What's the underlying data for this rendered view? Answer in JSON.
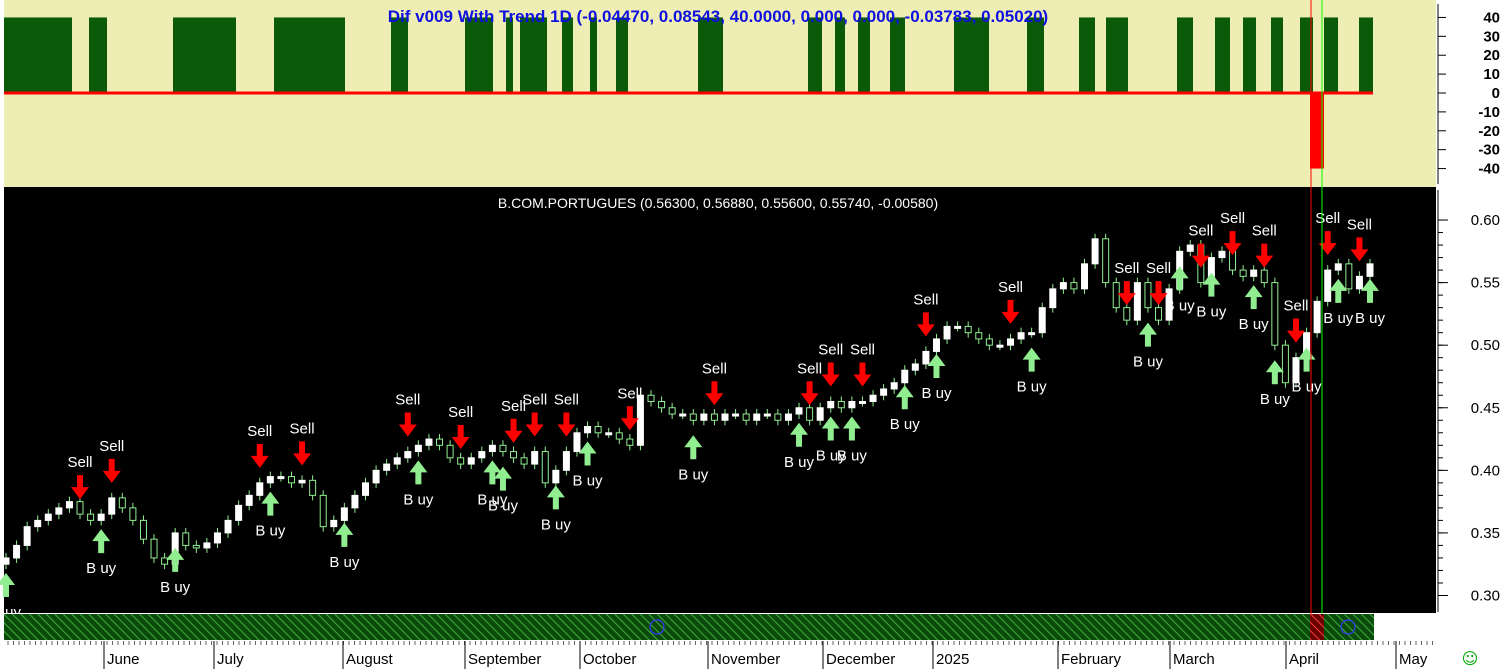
{
  "indicator": {
    "title": "Dif v009 With Trend 1D (-0.04470, 0.08543, 40.0000, 0.000, 0.000, -0.03783, 0.05020)",
    "y_ticks": [
      "40",
      "30",
      "20",
      "10",
      "0",
      "-10",
      "-20",
      "-30",
      "-40"
    ]
  },
  "price": {
    "title": "B.COM.PORTUGUES (0.56300, 0.56880, 0.55600, 0.55740, -0.00580)",
    "y_ticks": [
      "0.60",
      "0.55",
      "0.50",
      "0.45",
      "0.40",
      "0.35",
      "0.30"
    ]
  },
  "months": [
    "June",
    "July",
    "August",
    "September",
    "October",
    "November",
    "December",
    "2025",
    "February",
    "March",
    "April",
    "May"
  ],
  "colors": {
    "indicator_bg": "#eeeeb4",
    "indicator_bar": "#0a5a0a",
    "indicator_neg": "#ff0000",
    "price_bg": "#000000",
    "up_candle": "#ffffff",
    "wick": "#90ee90",
    "sell": "#ff0000",
    "buy": "#90ee90",
    "smiley": "#00aa00"
  },
  "signal_labels": {
    "sell": "Sell",
    "buy": "B uy"
  },
  "smiley": "☺",
  "chart_data": [
    {
      "type": "bar",
      "title": "Dif v009 With Trend 1D (-0.04470, 0.08543, 40.0000, 0.000, 0.000, -0.03783, 0.05020)",
      "ylim": [
        -45,
        45
      ],
      "ticks": [
        40,
        30,
        20,
        10,
        0,
        -10,
        -20,
        -30,
        -40
      ],
      "positive_blocks_level": 40,
      "negative_spike": {
        "month": "April",
        "value": -40
      }
    },
    {
      "type": "candlestick",
      "title": "B.COM.PORTUGUES (0.56300, 0.56880, 0.55600, 0.55740, -0.00580)",
      "last": {
        "open": 0.563,
        "high": 0.5688,
        "low": 0.556,
        "close": 0.5574,
        "change": -0.0058
      },
      "ylim": [
        0.29,
        0.62
      ],
      "ticks": [
        0.6,
        0.55,
        0.5,
        0.45,
        0.4,
        0.35,
        0.3
      ],
      "months": [
        "June",
        "July",
        "August",
        "September",
        "October",
        "November",
        "December",
        "2025",
        "February",
        "March",
        "April",
        "May"
      ],
      "close_path": [
        [
          0,
          0.33
        ],
        [
          1,
          0.34
        ],
        [
          2,
          0.355
        ],
        [
          3,
          0.36
        ],
        [
          4,
          0.365
        ],
        [
          5,
          0.37
        ],
        [
          6,
          0.375
        ],
        [
          7,
          0.365
        ],
        [
          8,
          0.36
        ],
        [
          9,
          0.365
        ],
        [
          10,
          0.378
        ],
        [
          11,
          0.37
        ],
        [
          12,
          0.36
        ],
        [
          13,
          0.345
        ],
        [
          14,
          0.33
        ],
        [
          15,
          0.325
        ],
        [
          16,
          0.35
        ],
        [
          17,
          0.34
        ],
        [
          18,
          0.338
        ],
        [
          19,
          0.342
        ],
        [
          20,
          0.35
        ],
        [
          21,
          0.36
        ],
        [
          22,
          0.372
        ],
        [
          23,
          0.38
        ],
        [
          24,
          0.39
        ],
        [
          25,
          0.395
        ],
        [
          26,
          0.395
        ],
        [
          27,
          0.39
        ],
        [
          28,
          0.392
        ],
        [
          29,
          0.38
        ],
        [
          30,
          0.355
        ],
        [
          31,
          0.36
        ],
        [
          32,
          0.37
        ],
        [
          33,
          0.38
        ],
        [
          34,
          0.39
        ],
        [
          35,
          0.4
        ],
        [
          36,
          0.405
        ],
        [
          37,
          0.41
        ],
        [
          38,
          0.415
        ],
        [
          39,
          0.42
        ],
        [
          40,
          0.425
        ],
        [
          41,
          0.42
        ],
        [
          42,
          0.41
        ],
        [
          43,
          0.405
        ],
        [
          44,
          0.41
        ],
        [
          45,
          0.415
        ],
        [
          46,
          0.42
        ],
        [
          47,
          0.415
        ],
        [
          48,
          0.41
        ],
        [
          49,
          0.405
        ],
        [
          50,
          0.415
        ],
        [
          51,
          0.39
        ],
        [
          52,
          0.4
        ],
        [
          53,
          0.415
        ],
        [
          54,
          0.43
        ],
        [
          55,
          0.435
        ],
        [
          56,
          0.43
        ],
        [
          57,
          0.43
        ],
        [
          58,
          0.425
        ],
        [
          59,
          0.42
        ],
        [
          60,
          0.46
        ],
        [
          61,
          0.455
        ],
        [
          62,
          0.45
        ],
        [
          63,
          0.445
        ],
        [
          64,
          0.445
        ],
        [
          65,
          0.44
        ],
        [
          66,
          0.445
        ],
        [
          67,
          0.44
        ],
        [
          68,
          0.445
        ],
        [
          69,
          0.445
        ],
        [
          70,
          0.44
        ],
        [
          71,
          0.445
        ],
        [
          72,
          0.445
        ],
        [
          73,
          0.44
        ],
        [
          74,
          0.445
        ],
        [
          75,
          0.45
        ],
        [
          76,
          0.44
        ],
        [
          77,
          0.45
        ],
        [
          78,
          0.455
        ],
        [
          79,
          0.45
        ],
        [
          80,
          0.455
        ],
        [
          81,
          0.455
        ],
        [
          82,
          0.46
        ],
        [
          83,
          0.465
        ],
        [
          84,
          0.47
        ],
        [
          85,
          0.48
        ],
        [
          86,
          0.485
        ],
        [
          87,
          0.495
        ],
        [
          88,
          0.505
        ],
        [
          89,
          0.515
        ],
        [
          90,
          0.515
        ],
        [
          91,
          0.51
        ],
        [
          92,
          0.505
        ],
        [
          93,
          0.5
        ],
        [
          94,
          0.5
        ],
        [
          95,
          0.505
        ],
        [
          96,
          0.51
        ],
        [
          97,
          0.51
        ],
        [
          98,
          0.53
        ],
        [
          99,
          0.545
        ],
        [
          100,
          0.55
        ],
        [
          101,
          0.545
        ],
        [
          102,
          0.565
        ],
        [
          103,
          0.585
        ],
        [
          104,
          0.55
        ],
        [
          105,
          0.53
        ],
        [
          106,
          0.52
        ],
        [
          107,
          0.55
        ],
        [
          108,
          0.53
        ],
        [
          109,
          0.52
        ],
        [
          110,
          0.545
        ],
        [
          111,
          0.575
        ],
        [
          112,
          0.58
        ],
        [
          113,
          0.55
        ],
        [
          114,
          0.57
        ],
        [
          115,
          0.575
        ],
        [
          116,
          0.56
        ],
        [
          117,
          0.555
        ],
        [
          118,
          0.56
        ],
        [
          119,
          0.55
        ],
        [
          120,
          0.5
        ],
        [
          121,
          0.47
        ],
        [
          122,
          0.49
        ],
        [
          123,
          0.51
        ],
        [
          124,
          0.535
        ],
        [
          125,
          0.56
        ],
        [
          126,
          0.565
        ],
        [
          127,
          0.545
        ],
        [
          128,
          0.555
        ],
        [
          129,
          0.565
        ]
      ],
      "signals": [
        {
          "type": "buy",
          "x": 0
        },
        {
          "type": "sell",
          "x": 7
        },
        {
          "type": "buy",
          "x": 9
        },
        {
          "type": "sell",
          "x": 10
        },
        {
          "type": "buy",
          "x": 16
        },
        {
          "type": "sell",
          "x": 24
        },
        {
          "type": "buy",
          "x": 25
        },
        {
          "type": "sell",
          "x": 28
        },
        {
          "type": "buy",
          "x": 32
        },
        {
          "type": "sell",
          "x": 38
        },
        {
          "type": "buy",
          "x": 39
        },
        {
          "type": "sell",
          "x": 43
        },
        {
          "type": "buy",
          "x": 46
        },
        {
          "type": "sell",
          "x": 48
        },
        {
          "type": "buy",
          "x": 47
        },
        {
          "type": "sell",
          "x": 50
        },
        {
          "type": "buy",
          "x": 52
        },
        {
          "type": "sell",
          "x": 53
        },
        {
          "type": "buy",
          "x": 55
        },
        {
          "type": "sell",
          "x": 59
        },
        {
          "type": "buy",
          "x": 65
        },
        {
          "type": "sell",
          "x": 67
        },
        {
          "type": "sell",
          "x": 76
        },
        {
          "type": "buy",
          "x": 75
        },
        {
          "type": "sell",
          "x": 78
        },
        {
          "type": "buy",
          "x": 78
        },
        {
          "type": "sell",
          "x": 81
        },
        {
          "type": "buy",
          "x": 80
        },
        {
          "type": "buy",
          "x": 85
        },
        {
          "type": "sell",
          "x": 87
        },
        {
          "type": "buy",
          "x": 88
        },
        {
          "type": "sell",
          "x": 95
        },
        {
          "type": "buy",
          "x": 97
        },
        {
          "type": "sell",
          "x": 106
        },
        {
          "type": "buy",
          "x": 108
        },
        {
          "type": "sell",
          "x": 109
        },
        {
          "type": "buy",
          "x": 111
        },
        {
          "type": "sell",
          "x": 113
        },
        {
          "type": "buy",
          "x": 114
        },
        {
          "type": "sell",
          "x": 116
        },
        {
          "type": "buy",
          "x": 118
        },
        {
          "type": "sell",
          "x": 119
        },
        {
          "type": "buy",
          "x": 120
        },
        {
          "type": "sell",
          "x": 122
        },
        {
          "type": "buy",
          "x": 123
        },
        {
          "type": "sell",
          "x": 125
        },
        {
          "type": "buy",
          "x": 126
        },
        {
          "type": "sell",
          "x": 128
        },
        {
          "type": "buy",
          "x": 130
        }
      ]
    }
  ]
}
